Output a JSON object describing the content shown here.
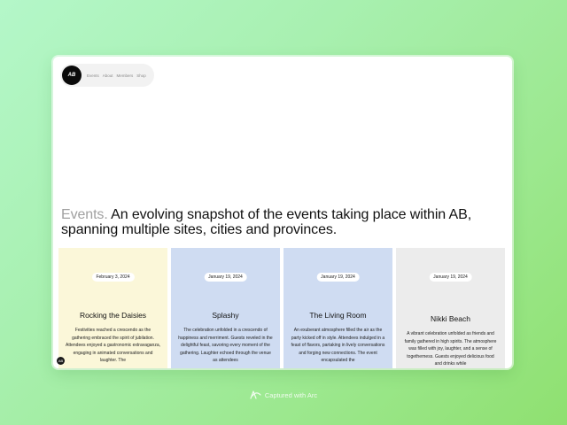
{
  "nav": {
    "logo_text": "AB",
    "links": [
      "Events",
      "About",
      "Members",
      "Shop"
    ]
  },
  "headline": {
    "muted": "Events.",
    "text": " An evolving snapshot of the events taking place within AB, spanning multiple sites, cities and provinces."
  },
  "cards": [
    {
      "date": "February 3, 2024",
      "title": "Rocking the Daisies",
      "description": "Festivities reached a crescendo as the gathering embraced the spirit of jubilation. Attendees enjoyed a gastronomic extravaganza, engaging in animated conversations and laughter. The",
      "color": "#fbf7d9"
    },
    {
      "date": "January 19, 2024",
      "title": "Splashy",
      "description": "The celebration unfolded in a crescendo of happiness and merriment. Guests reveled in the delightful feast, savoring every moment of the gathering. Laughter echoed through the venue as attendees",
      "color": "#cfdcf2"
    },
    {
      "date": "January 19, 2024",
      "title": "The Living Room",
      "description": "An exuberant atmosphere filled the air as the party kicked off in style. Attendees indulged in a feast of flavors, partaking in lively conversations and forging new connections. The event encapsulated the",
      "color": "#cfdcf2"
    },
    {
      "date": "January 19, 2024",
      "title": "Nikki Beach",
      "description": "A vibrant celebration unfolded as friends and family gathered in high spirits. The atmosphere was filled with joy, laughter, and a sense of togetherness. Guests enjoyed delicious food and drinks while",
      "color": "#ececec"
    }
  ],
  "badge_text": "AB",
  "footer": {
    "text": "Captured with Arc"
  }
}
